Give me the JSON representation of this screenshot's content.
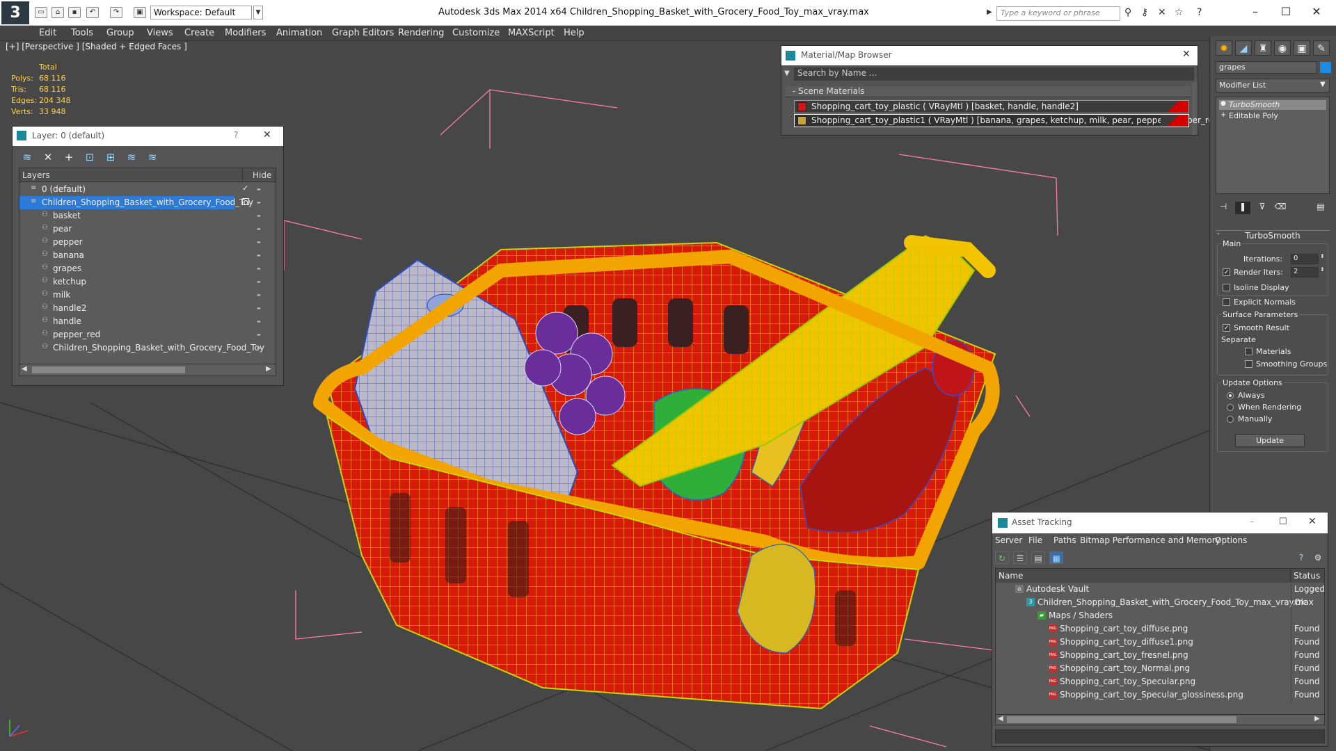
{
  "app": {
    "title": "Autodesk 3ds Max  2014 x64      Children_Shopping_Basket_with_Grocery_Food_Toy_max_vray.max",
    "workspace": "Workspace: Default",
    "search_placeholder": "Type a keyword or phrase"
  },
  "menu": [
    "Edit",
    "Tools",
    "Group",
    "Views",
    "Create",
    "Modifiers",
    "Animation",
    "Graph Editors",
    "Rendering",
    "Customize",
    "MAXScript",
    "Help"
  ],
  "viewport": {
    "label": "[+] [Perspective ] [Shaded + Edged Faces ]",
    "stats": {
      "total_label": "Total",
      "rows": [
        {
          "label": "Polys:",
          "value": "68 116"
        },
        {
          "label": "Tris:",
          "value": "68 116"
        },
        {
          "label": "Edges:",
          "value": "204 348"
        },
        {
          "label": "Verts:",
          "value": "33 948"
        }
      ]
    }
  },
  "layer_window": {
    "title": "Layer: 0 (default)",
    "help": "?",
    "col_layers": "Layers",
    "col_hide": "Hide",
    "rows": [
      {
        "name": "0 (default)",
        "level": 0,
        "selected": false
      },
      {
        "name": "Children_Shopping_Basket_with_Grocery_Food_Toy",
        "level": 0,
        "selected": true
      },
      {
        "name": "basket",
        "level": 1,
        "selected": false
      },
      {
        "name": "pear",
        "level": 1,
        "selected": false
      },
      {
        "name": "pepper",
        "level": 1,
        "selected": false
      },
      {
        "name": "banana",
        "level": 1,
        "selected": false
      },
      {
        "name": "grapes",
        "level": 1,
        "selected": false
      },
      {
        "name": "ketchup",
        "level": 1,
        "selected": false
      },
      {
        "name": "milk",
        "level": 1,
        "selected": false
      },
      {
        "name": "handle2",
        "level": 1,
        "selected": false
      },
      {
        "name": "handle",
        "level": 1,
        "selected": false
      },
      {
        "name": "pepper_red",
        "level": 1,
        "selected": false
      },
      {
        "name": "Children_Shopping_Basket_with_Grocery_Food_Toy",
        "level": 1,
        "selected": false
      }
    ]
  },
  "material_browser": {
    "title": "Material/Map Browser",
    "search_placeholder": "Search by Name ...",
    "section": "- Scene Materials",
    "materials": [
      {
        "name": "Shopping_cart_toy_plastic  ( VRayMtl )  [basket, handle, handle2]",
        "swatch": "#d21414"
      },
      {
        "name": "Shopping_cart_toy_plastic1  ( VRayMtl )  [banana, grapes, ketchup, milk, pear, pepper, pepper_red]",
        "swatch": "#c8a43a"
      }
    ]
  },
  "command_panel": {
    "object_name": "grapes",
    "object_color": "#1e8be0",
    "modifier_list": "Modifier List",
    "stack": [
      {
        "name": "TurboSmooth",
        "selected": true
      },
      {
        "name": "Editable Poly",
        "selected": false
      }
    ],
    "rollout_title": "TurboSmooth",
    "main_label": "Main",
    "iterations_label": "Iterations:",
    "iterations_value": "0",
    "render_iters_label": "Render Iters:",
    "render_iters_value": "2",
    "isoline_label": "Isoline Display",
    "explicit_normals_label": "Explicit Normals",
    "surface_params_label": "Surface Parameters",
    "smooth_result_label": "Smooth Result",
    "separate_label": "Separate",
    "materials_label": "Materials",
    "smoothing_groups_label": "Smoothing Groups",
    "update_options_label": "Update Options",
    "always_label": "Always",
    "when_rendering_label": "When Rendering",
    "manually_label": "Manually",
    "update_button": "Update"
  },
  "asset_tracking": {
    "title": "Asset Tracking",
    "menu": [
      "Server",
      "File",
      "Paths",
      "Bitmap Performance and Memory",
      "Options"
    ],
    "col_name": "Name",
    "col_status": "Status",
    "rows": [
      {
        "name": "Autodesk Vault",
        "status": "Logged Ou",
        "level": 1,
        "icon": "vault"
      },
      {
        "name": "Children_Shopping_Basket_with_Grocery_Food_Toy_max_vray.max",
        "status": "Ok",
        "level": 2,
        "icon": "file"
      },
      {
        "name": "Maps / Shaders",
        "status": "",
        "level": 3,
        "icon": "folder"
      },
      {
        "name": "Shopping_cart_toy_diffuse.png",
        "status": "Found",
        "level": 4,
        "icon": "png"
      },
      {
        "name": "Shopping_cart_toy_diffuse1.png",
        "status": "Found",
        "level": 4,
        "icon": "png"
      },
      {
        "name": "Shopping_cart_toy_fresnel.png",
        "status": "Found",
        "level": 4,
        "icon": "png"
      },
      {
        "name": "Shopping_cart_toy_Normal.png",
        "status": "Found",
        "level": 4,
        "icon": "png"
      },
      {
        "name": "Shopping_cart_toy_Specular.png",
        "status": "Found",
        "level": 4,
        "icon": "png"
      },
      {
        "name": "Shopping_cart_toy_Specular_glossiness.png",
        "status": "Found",
        "level": 4,
        "icon": "png"
      }
    ]
  }
}
